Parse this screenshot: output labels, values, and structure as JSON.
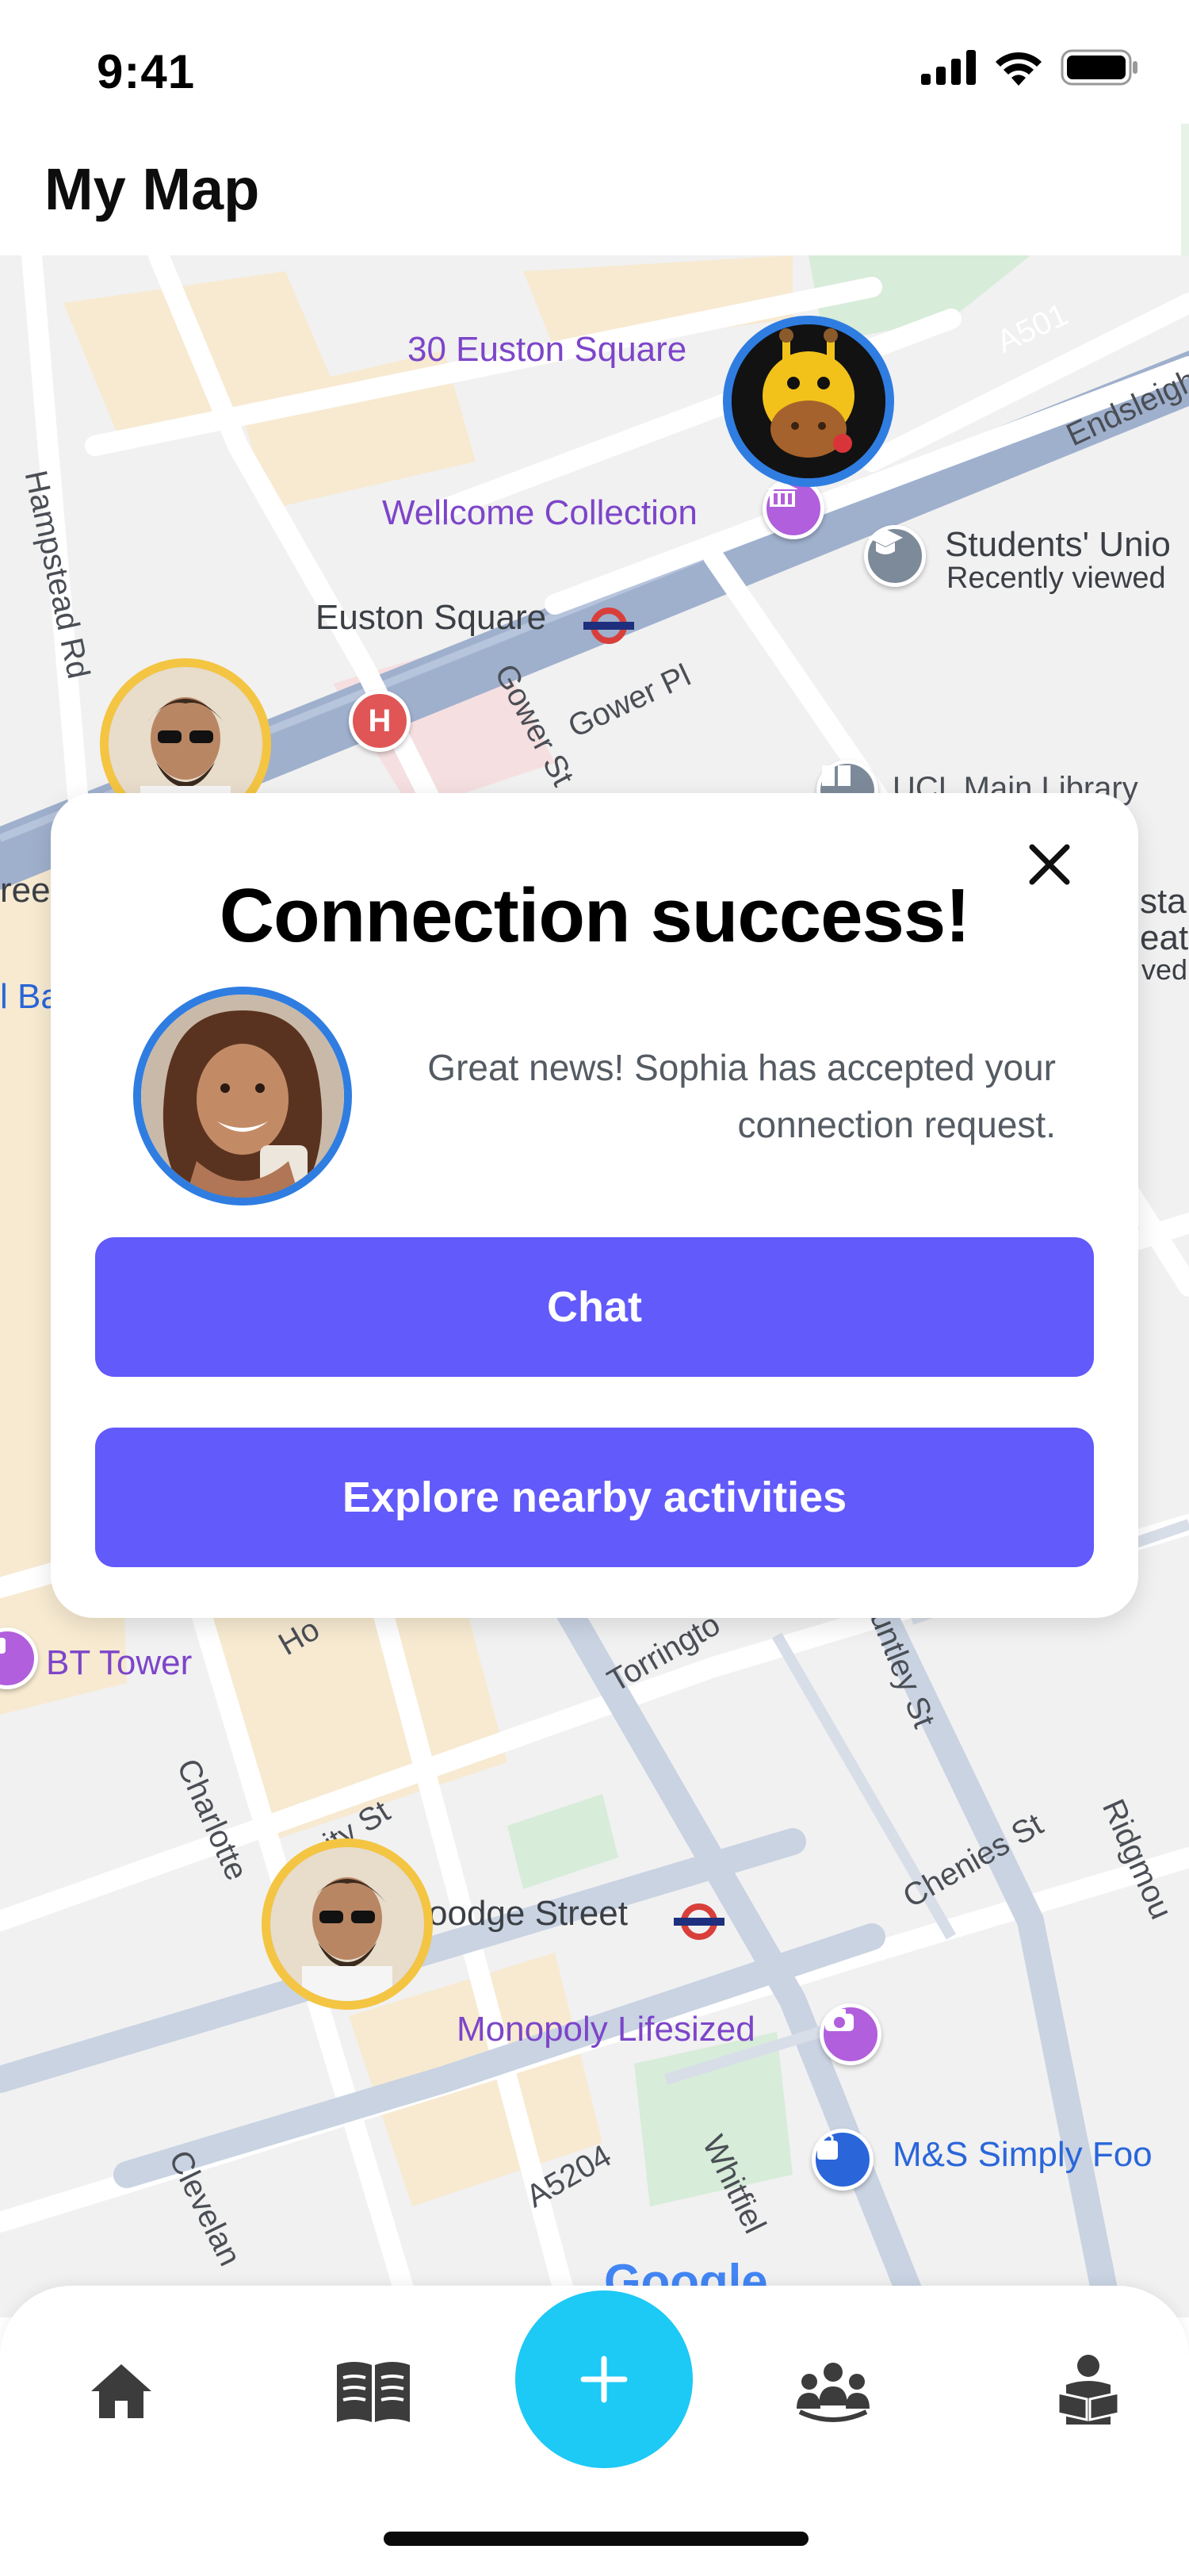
{
  "status_bar": {
    "time": "9:41"
  },
  "header": {
    "title": "My Map"
  },
  "map": {
    "labels": {
      "euston_square_30": "30 Euston Square",
      "wellcome": "Wellcome Collection",
      "euston_square": "Euston Square",
      "students_union": "Students' Unio",
      "recently_viewed": "Recently viewed",
      "hampstead_rd": "Hampstead Rd",
      "gower_st": "Gower St",
      "gower_pl": "Gower Pl",
      "ucl_library": "UCL Main Library",
      "a501": "A501",
      "endsleigh": "Endsleigh",
      "bt_tower": "BT Tower",
      "torrington": "Torringto",
      "huntley": "untley St",
      "charlotte": "Charlotte",
      "goodge_street": "oodge Street",
      "chenies": "Chenies St",
      "ridgmount": "Ridgmou",
      "monopoly": "Monopoly Lifesized",
      "ms_food": "M&S Simply Foo",
      "a5204": "A5204",
      "whitfield": "Whitfiel",
      "cleveland": "Clevelan",
      "google": "Google",
      "left_fragment": "ree",
      "left_fragment2": "l Ba",
      "right_fragment": "sta",
      "right_fragment2": "eat",
      "right_fragment3": "ved",
      "ity_st": "ity St",
      "ho": "Ho",
      "hospital_letter": "H"
    }
  },
  "modal": {
    "title": "Connection success!",
    "message_line1": "Great news! Sophia has accepted your",
    "message_line2": "connection request.",
    "chat_label": "Chat",
    "explore_label": "Explore nearby activities"
  },
  "nav": {
    "items": [
      "home-icon",
      "book-icon",
      "add-icon",
      "group-icon",
      "reader-icon"
    ]
  },
  "colors": {
    "accent": "#625afa",
    "fab": "#1dc9f5",
    "marker_blue": "#2f7de1",
    "marker_yellow": "#f4c542",
    "poi_purple": "#b15fdc"
  }
}
